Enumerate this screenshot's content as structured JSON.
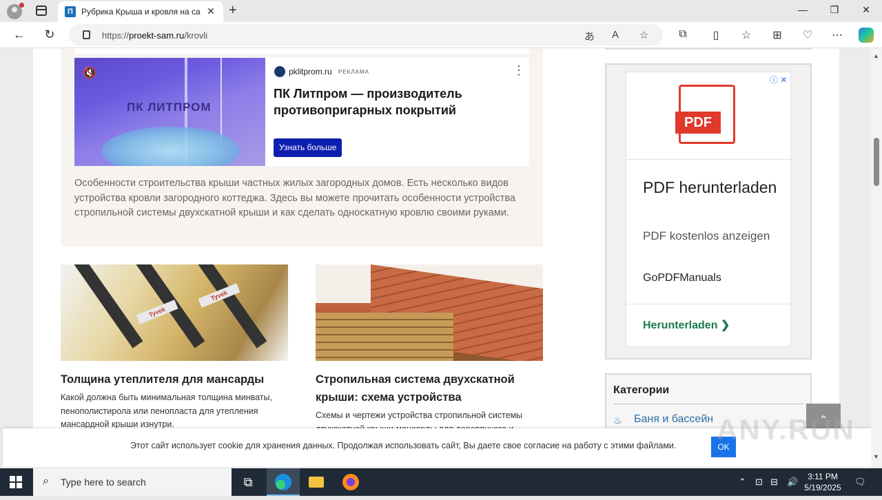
{
  "browser": {
    "tab_title": "Рубрика Крыша и кровля на са",
    "tab_favicon": "П",
    "url_prefix": "https://",
    "url_host": "proekt-sam.ru",
    "url_path": "/krovli"
  },
  "ad_top": {
    "image_brand": "ПК ЛИТПРОМ",
    "site": "pklitprom.ru",
    "label": "РЕКЛАМА",
    "title": "ПК Литпром — производитель противопригарных покрытий",
    "button": "Узнать больше"
  },
  "intro": {
    "text": "Особенности строительства крыши частных жилых загородных домов. Есть несколько видов устройства кровли загородного коттеджа. Здесь вы можете прочитать особенности устройства стропильной системы двухскатной крыши и как сделать односкатную кровлю своими руками."
  },
  "articles": [
    {
      "image_label": "Tyvek",
      "title": "Толщина утеплителя для мансарды",
      "desc": "Какой должна быть минимальная толщина минваты, пенополистирола или пенопласта для утепления мансардной крыши изнутри."
    },
    {
      "title": "Стропильная система двухскатной крыши: схема устройства",
      "desc": "Схемы и чертежи устройства стропильной системы двухскатной крыши мансарды для деревянного и"
    }
  ],
  "side_ad": {
    "icon_label": "PDF",
    "title": "PDF herunterladen",
    "subtitle": "PDF kostenlos anzeigen",
    "brand": "GoPDFManuals",
    "cta": "Herunterladen"
  },
  "categories": {
    "title": "Категории",
    "items": [
      "Баня и бассейн"
    ]
  },
  "cookie": {
    "text": "Этот сайт использует cookie для хранения данных. Продолжая использовать сайт, Вы даете свое согласие на работу с этими файлами.",
    "button": "OK"
  },
  "watermark": "ANY.RUN",
  "taskbar": {
    "search_placeholder": "Type here to search",
    "time": "3:11 PM",
    "date": "5/19/2025"
  }
}
